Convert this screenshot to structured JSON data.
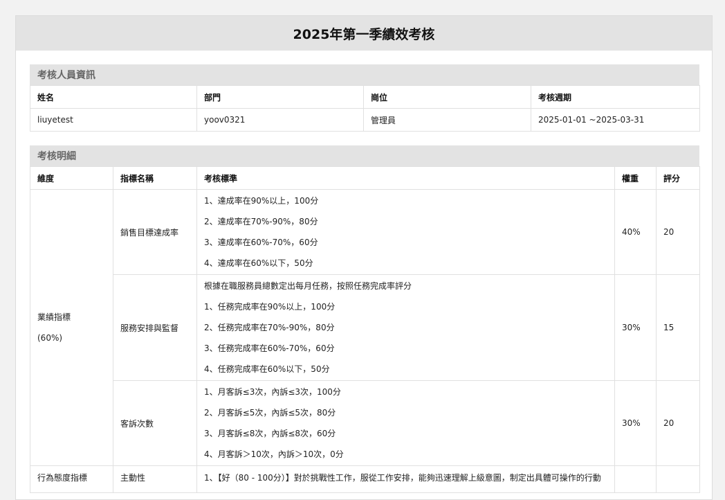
{
  "title": "2025年第一季績效考核",
  "info": {
    "heading": "考核人員資訊",
    "headers": [
      "姓名",
      "部門",
      "崗位",
      "考核週期"
    ],
    "values": [
      "liuyetest",
      "yoov0321",
      "管理員",
      "2025-01-01 ~2025-03-31"
    ]
  },
  "detail": {
    "heading": "考核明細",
    "headers": [
      "維度",
      "指標名稱",
      "考核標準",
      "權重",
      "評分"
    ],
    "dimension1": {
      "name": "業績指標",
      "weight": "(60%)"
    },
    "rows": [
      {
        "indicator": "銷售目標達成率",
        "criteria": [
          "1、達成率在90%以上，100分",
          "2、達成率在70%-90%，80分",
          "3、達成率在60%-70%，60分",
          "4、達成率在60%以下，50分"
        ],
        "weight": "40%",
        "score": "20"
      },
      {
        "indicator": "服務安排與監督",
        "criteria": [
          "根據在職服務員總數定出每月任務，按照任務完成率評分",
          "1、任務完成率在90%以上，100分",
          "2、任務完成率在70%-90%，80分",
          "3、任務完成率在60%-70%，60分",
          "4、任務完成率在60%以下，50分"
        ],
        "weight": "30%",
        "score": "15"
      },
      {
        "indicator": "客訴次數",
        "criteria": [
          "1、月客訴≤3次，內訴≤3次，100分",
          "2、月客訴≤5次，內訴≤5次，80分",
          "3、月客訴≤8次，內訴≤8次，60分",
          "4、月客訴＞10次，內訴＞10次，0分"
        ],
        "weight": "30%",
        "score": "20"
      }
    ],
    "partial_row": {
      "dimension": "行為態度指標",
      "indicator": "主動性",
      "criteria": "1、【好（80 - 100分）】對於挑戰性工作，服從工作安排，能夠迅速理解上級意圖，制定出具體可操作的行動"
    }
  }
}
